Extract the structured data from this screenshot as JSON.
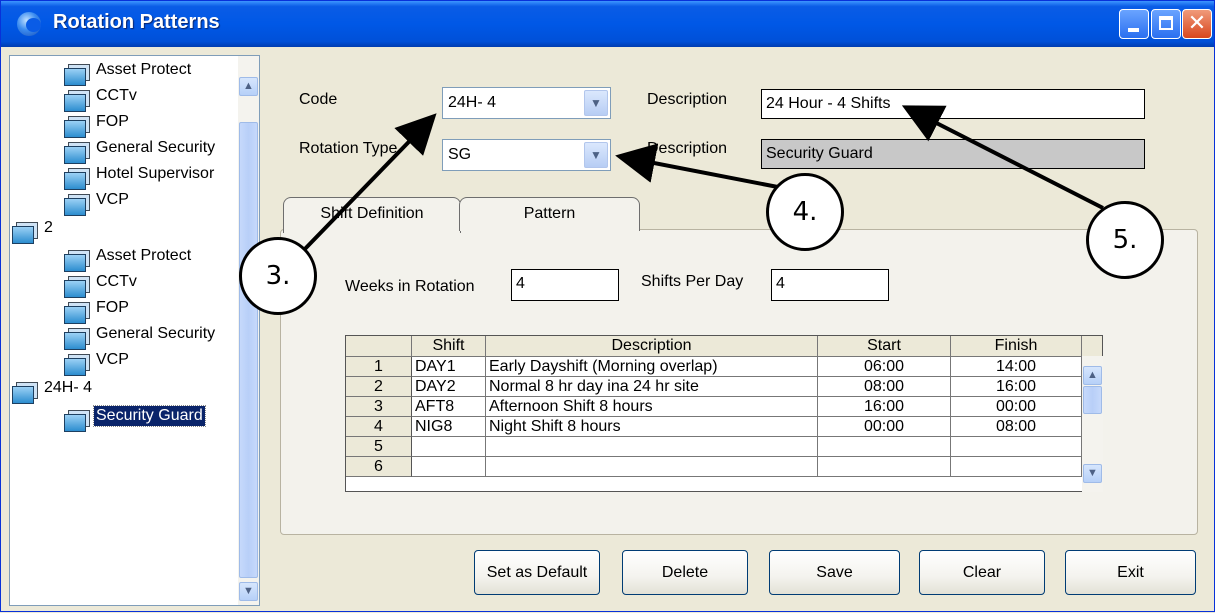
{
  "window": {
    "title": "Rotation Patterns"
  },
  "tree": {
    "items": [
      {
        "label": "Asset Protect",
        "level": 1
      },
      {
        "label": "CCTv",
        "level": 1
      },
      {
        "label": "FOP",
        "level": 1
      },
      {
        "label": "General Security",
        "level": 1
      },
      {
        "label": "Hotel Supervisor",
        "level": 1
      },
      {
        "label": "VCP",
        "level": 1
      },
      {
        "label": "2",
        "level": 0
      },
      {
        "label": "Asset Protect",
        "level": 1
      },
      {
        "label": "CCTv",
        "level": 1
      },
      {
        "label": "FOP",
        "level": 1
      },
      {
        "label": "General Security",
        "level": 1
      },
      {
        "label": "VCP",
        "level": 1
      },
      {
        "label": "24H- 4",
        "level": 0
      },
      {
        "label": "Security Guard",
        "level": 1,
        "selected": true
      }
    ]
  },
  "form": {
    "code_label": "Code",
    "code_value": "24H- 4",
    "description_label": "Description",
    "description_value": "24 Hour - 4 Shifts",
    "rotation_type_label": "Rotation Type",
    "rotation_type_value": "SG",
    "rotation_description_label": "Description",
    "rotation_description_value": "Security Guard"
  },
  "tabs": [
    {
      "label": "Shift Definition",
      "active": true
    },
    {
      "label": "Pattern",
      "active": false
    }
  ],
  "shift_def": {
    "weeks_label": "Weeks in Rotation",
    "weeks_value": "4",
    "shifts_label": "Shifts Per Day",
    "shifts_value": "4"
  },
  "grid": {
    "columns": [
      "Shift",
      "Description",
      "Start",
      "Finish"
    ],
    "rows": [
      {
        "num": "1",
        "shift": "DAY1",
        "description": "Early Dayshift (Morning overlap)",
        "start": "06:00",
        "finish": "14:00"
      },
      {
        "num": "2",
        "shift": "DAY2",
        "description": "Normal 8 hr day ina 24 hr site",
        "start": "08:00",
        "finish": "16:00"
      },
      {
        "num": "3",
        "shift": "AFT8",
        "description": "Afternoon Shift 8 hours",
        "start": "16:00",
        "finish": "00:00"
      },
      {
        "num": "4",
        "shift": "NIG8",
        "description": "Night Shift 8 hours",
        "start": "00:00",
        "finish": "08:00"
      },
      {
        "num": "5",
        "shift": "",
        "description": "",
        "start": "",
        "finish": ""
      },
      {
        "num": "6",
        "shift": "",
        "description": "",
        "start": "",
        "finish": ""
      }
    ]
  },
  "buttons": {
    "set_default": "Set as Default",
    "delete": "Delete",
    "save": "Save",
    "clear": "Clear",
    "exit": "Exit"
  },
  "callouts": {
    "c3": "3.",
    "c4": "4.",
    "c5": "5."
  },
  "colors": {
    "titlebar": "#0058e6",
    "selection": "#0a246a",
    "window_bg": "#ece9d8"
  }
}
